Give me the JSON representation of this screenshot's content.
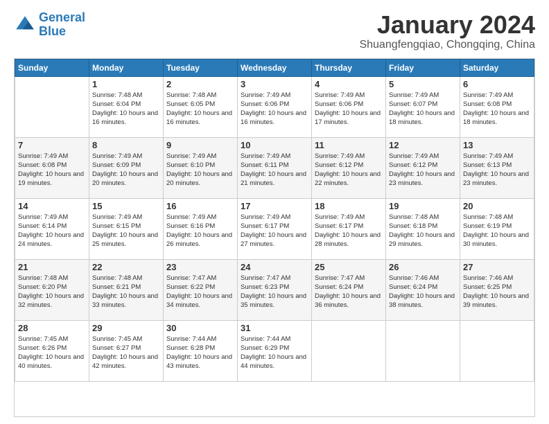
{
  "header": {
    "logo_line1": "General",
    "logo_line2": "Blue",
    "month": "January 2024",
    "location": "Shuangfengqiao, Chongqing, China"
  },
  "weekdays": [
    "Sunday",
    "Monday",
    "Tuesday",
    "Wednesday",
    "Thursday",
    "Friday",
    "Saturday"
  ],
  "weeks": [
    [
      {
        "day": "",
        "sunrise": "",
        "sunset": "",
        "daylight": ""
      },
      {
        "day": "1",
        "sunrise": "Sunrise: 7:48 AM",
        "sunset": "Sunset: 6:04 PM",
        "daylight": "Daylight: 10 hours and 16 minutes."
      },
      {
        "day": "2",
        "sunrise": "Sunrise: 7:48 AM",
        "sunset": "Sunset: 6:05 PM",
        "daylight": "Daylight: 10 hours and 16 minutes."
      },
      {
        "day": "3",
        "sunrise": "Sunrise: 7:49 AM",
        "sunset": "Sunset: 6:06 PM",
        "daylight": "Daylight: 10 hours and 16 minutes."
      },
      {
        "day": "4",
        "sunrise": "Sunrise: 7:49 AM",
        "sunset": "Sunset: 6:06 PM",
        "daylight": "Daylight: 10 hours and 17 minutes."
      },
      {
        "day": "5",
        "sunrise": "Sunrise: 7:49 AM",
        "sunset": "Sunset: 6:07 PM",
        "daylight": "Daylight: 10 hours and 18 minutes."
      },
      {
        "day": "6",
        "sunrise": "Sunrise: 7:49 AM",
        "sunset": "Sunset: 6:08 PM",
        "daylight": "Daylight: 10 hours and 18 minutes."
      }
    ],
    [
      {
        "day": "7",
        "sunrise": "Sunrise: 7:49 AM",
        "sunset": "Sunset: 6:08 PM",
        "daylight": "Daylight: 10 hours and 19 minutes."
      },
      {
        "day": "8",
        "sunrise": "Sunrise: 7:49 AM",
        "sunset": "Sunset: 6:09 PM",
        "daylight": "Daylight: 10 hours and 20 minutes."
      },
      {
        "day": "9",
        "sunrise": "Sunrise: 7:49 AM",
        "sunset": "Sunset: 6:10 PM",
        "daylight": "Daylight: 10 hours and 20 minutes."
      },
      {
        "day": "10",
        "sunrise": "Sunrise: 7:49 AM",
        "sunset": "Sunset: 6:11 PM",
        "daylight": "Daylight: 10 hours and 21 minutes."
      },
      {
        "day": "11",
        "sunrise": "Sunrise: 7:49 AM",
        "sunset": "Sunset: 6:12 PM",
        "daylight": "Daylight: 10 hours and 22 minutes."
      },
      {
        "day": "12",
        "sunrise": "Sunrise: 7:49 AM",
        "sunset": "Sunset: 6:12 PM",
        "daylight": "Daylight: 10 hours and 23 minutes."
      },
      {
        "day": "13",
        "sunrise": "Sunrise: 7:49 AM",
        "sunset": "Sunset: 6:13 PM",
        "daylight": "Daylight: 10 hours and 23 minutes."
      }
    ],
    [
      {
        "day": "14",
        "sunrise": "Sunrise: 7:49 AM",
        "sunset": "Sunset: 6:14 PM",
        "daylight": "Daylight: 10 hours and 24 minutes."
      },
      {
        "day": "15",
        "sunrise": "Sunrise: 7:49 AM",
        "sunset": "Sunset: 6:15 PM",
        "daylight": "Daylight: 10 hours and 25 minutes."
      },
      {
        "day": "16",
        "sunrise": "Sunrise: 7:49 AM",
        "sunset": "Sunset: 6:16 PM",
        "daylight": "Daylight: 10 hours and 26 minutes."
      },
      {
        "day": "17",
        "sunrise": "Sunrise: 7:49 AM",
        "sunset": "Sunset: 6:17 PM",
        "daylight": "Daylight: 10 hours and 27 minutes."
      },
      {
        "day": "18",
        "sunrise": "Sunrise: 7:49 AM",
        "sunset": "Sunset: 6:17 PM",
        "daylight": "Daylight: 10 hours and 28 minutes."
      },
      {
        "day": "19",
        "sunrise": "Sunrise: 7:48 AM",
        "sunset": "Sunset: 6:18 PM",
        "daylight": "Daylight: 10 hours and 29 minutes."
      },
      {
        "day": "20",
        "sunrise": "Sunrise: 7:48 AM",
        "sunset": "Sunset: 6:19 PM",
        "daylight": "Daylight: 10 hours and 30 minutes."
      }
    ],
    [
      {
        "day": "21",
        "sunrise": "Sunrise: 7:48 AM",
        "sunset": "Sunset: 6:20 PM",
        "daylight": "Daylight: 10 hours and 32 minutes."
      },
      {
        "day": "22",
        "sunrise": "Sunrise: 7:48 AM",
        "sunset": "Sunset: 6:21 PM",
        "daylight": "Daylight: 10 hours and 33 minutes."
      },
      {
        "day": "23",
        "sunrise": "Sunrise: 7:47 AM",
        "sunset": "Sunset: 6:22 PM",
        "daylight": "Daylight: 10 hours and 34 minutes."
      },
      {
        "day": "24",
        "sunrise": "Sunrise: 7:47 AM",
        "sunset": "Sunset: 6:23 PM",
        "daylight": "Daylight: 10 hours and 35 minutes."
      },
      {
        "day": "25",
        "sunrise": "Sunrise: 7:47 AM",
        "sunset": "Sunset: 6:24 PM",
        "daylight": "Daylight: 10 hours and 36 minutes."
      },
      {
        "day": "26",
        "sunrise": "Sunrise: 7:46 AM",
        "sunset": "Sunset: 6:24 PM",
        "daylight": "Daylight: 10 hours and 38 minutes."
      },
      {
        "day": "27",
        "sunrise": "Sunrise: 7:46 AM",
        "sunset": "Sunset: 6:25 PM",
        "daylight": "Daylight: 10 hours and 39 minutes."
      }
    ],
    [
      {
        "day": "28",
        "sunrise": "Sunrise: 7:45 AM",
        "sunset": "Sunset: 6:26 PM",
        "daylight": "Daylight: 10 hours and 40 minutes."
      },
      {
        "day": "29",
        "sunrise": "Sunrise: 7:45 AM",
        "sunset": "Sunset: 6:27 PM",
        "daylight": "Daylight: 10 hours and 42 minutes."
      },
      {
        "day": "30",
        "sunrise": "Sunrise: 7:44 AM",
        "sunset": "Sunset: 6:28 PM",
        "daylight": "Daylight: 10 hours and 43 minutes."
      },
      {
        "day": "31",
        "sunrise": "Sunrise: 7:44 AM",
        "sunset": "Sunset: 6:29 PM",
        "daylight": "Daylight: 10 hours and 44 minutes."
      },
      {
        "day": "",
        "sunrise": "",
        "sunset": "",
        "daylight": ""
      },
      {
        "day": "",
        "sunrise": "",
        "sunset": "",
        "daylight": ""
      },
      {
        "day": "",
        "sunrise": "",
        "sunset": "",
        "daylight": ""
      }
    ]
  ]
}
